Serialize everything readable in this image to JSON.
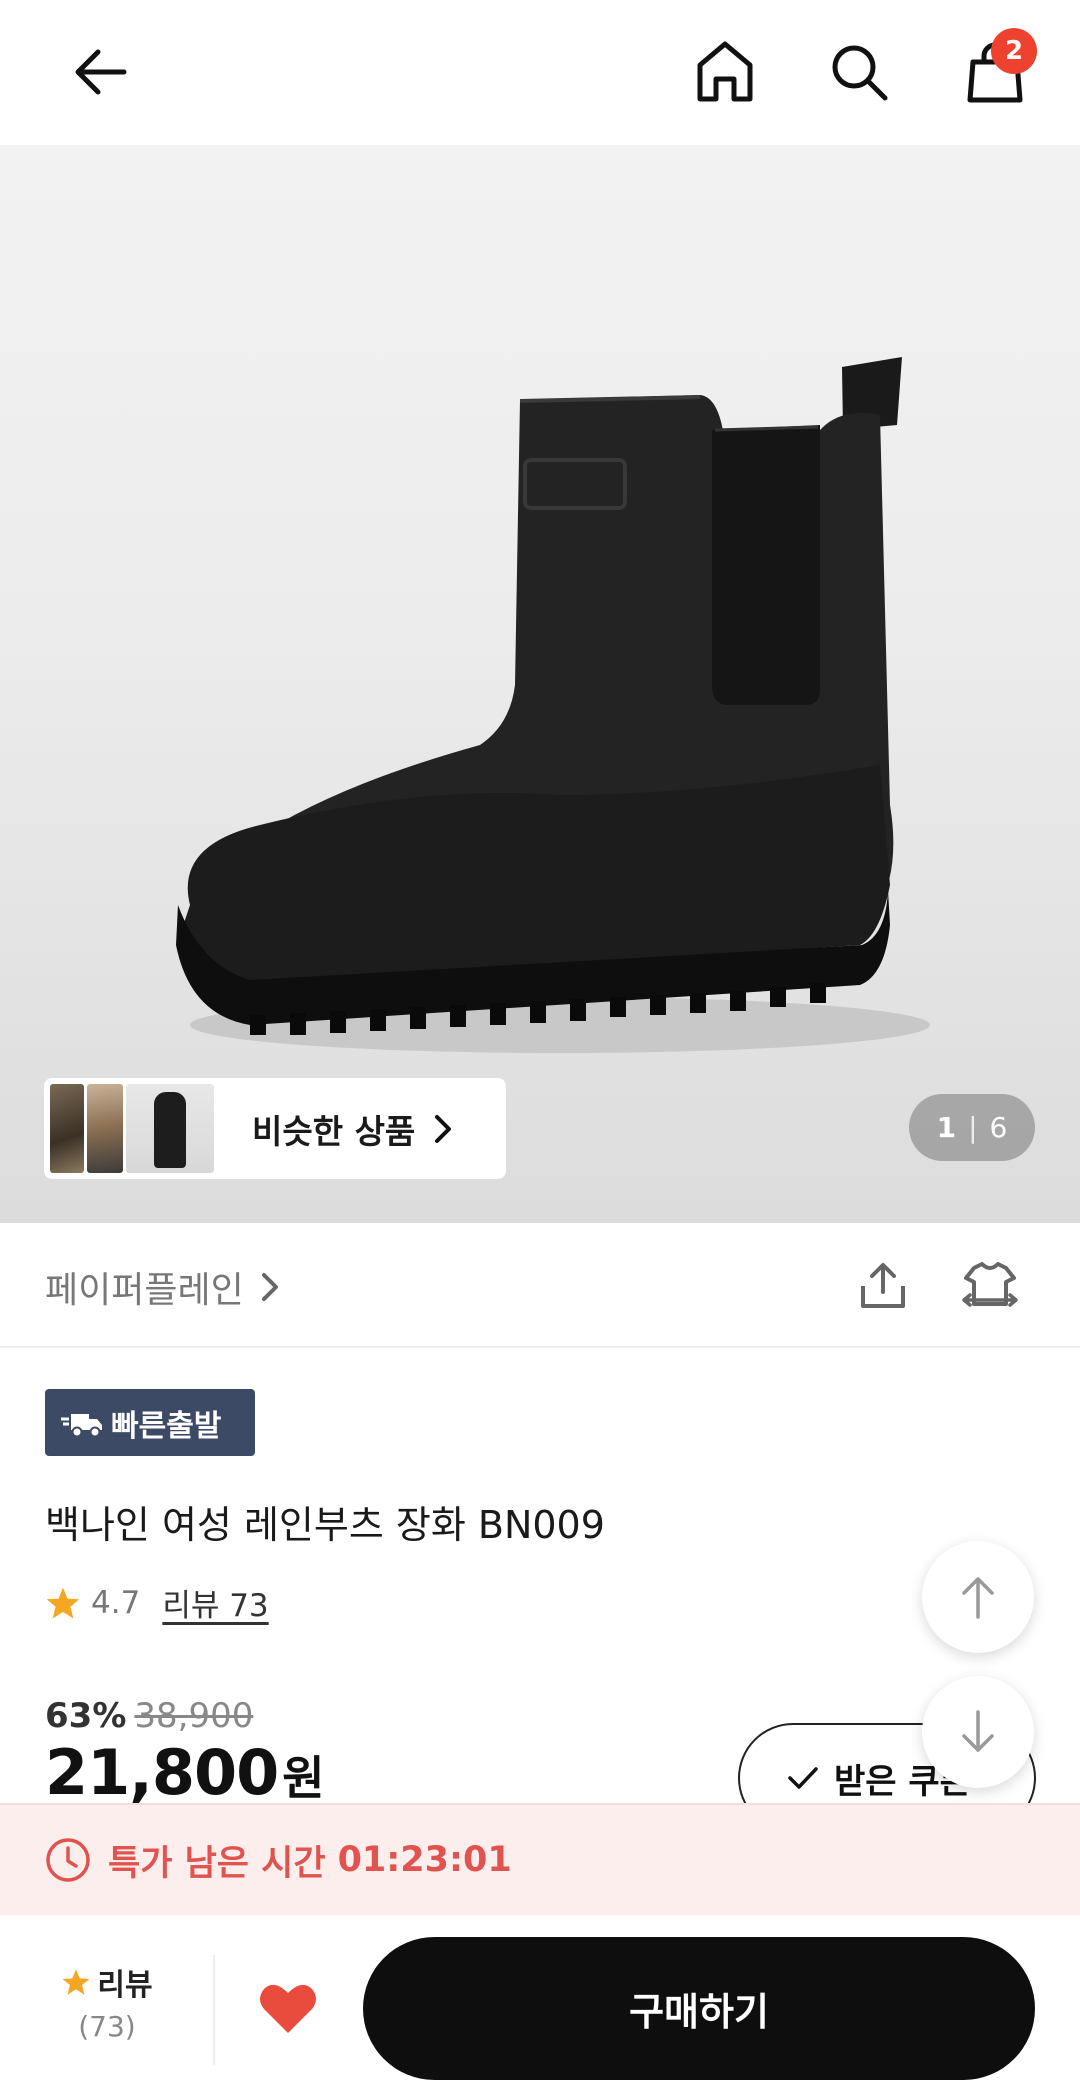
{
  "header": {
    "back_icon": "arrow-left-icon",
    "home_icon": "home-icon",
    "search_icon": "search-icon",
    "cart_icon": "shopping-bag-icon",
    "cart_count": "2"
  },
  "gallery": {
    "similar_label": "비슷한 상품",
    "page_current": "1",
    "page_separator": "|",
    "page_total": "6"
  },
  "brand": {
    "name": "페이퍼플레인",
    "share_icon": "share-icon",
    "fit_icon": "clothing-size-icon"
  },
  "product": {
    "badge": "빠른출발",
    "title": "백나인 여성 레인부츠 장화 BN009",
    "rating": "4.7",
    "reviews_label": "리뷰 73",
    "discount": "63%",
    "original_price": "38,900",
    "price": "21,800",
    "currency": "원",
    "coupon_label": "받은 쿠폰"
  },
  "timer": {
    "label": "특가 남은 시간",
    "time": "01:23:01"
  },
  "bottom_bar": {
    "review_label": "리뷰",
    "review_count": "(73)",
    "buy_label": "구매하기"
  },
  "colors": {
    "accent_red": "#ef4130",
    "timer_red": "#e0534e",
    "badge_navy": "#3d4a66",
    "buy_black": "#0e0e0e",
    "star": "#f5a623"
  }
}
